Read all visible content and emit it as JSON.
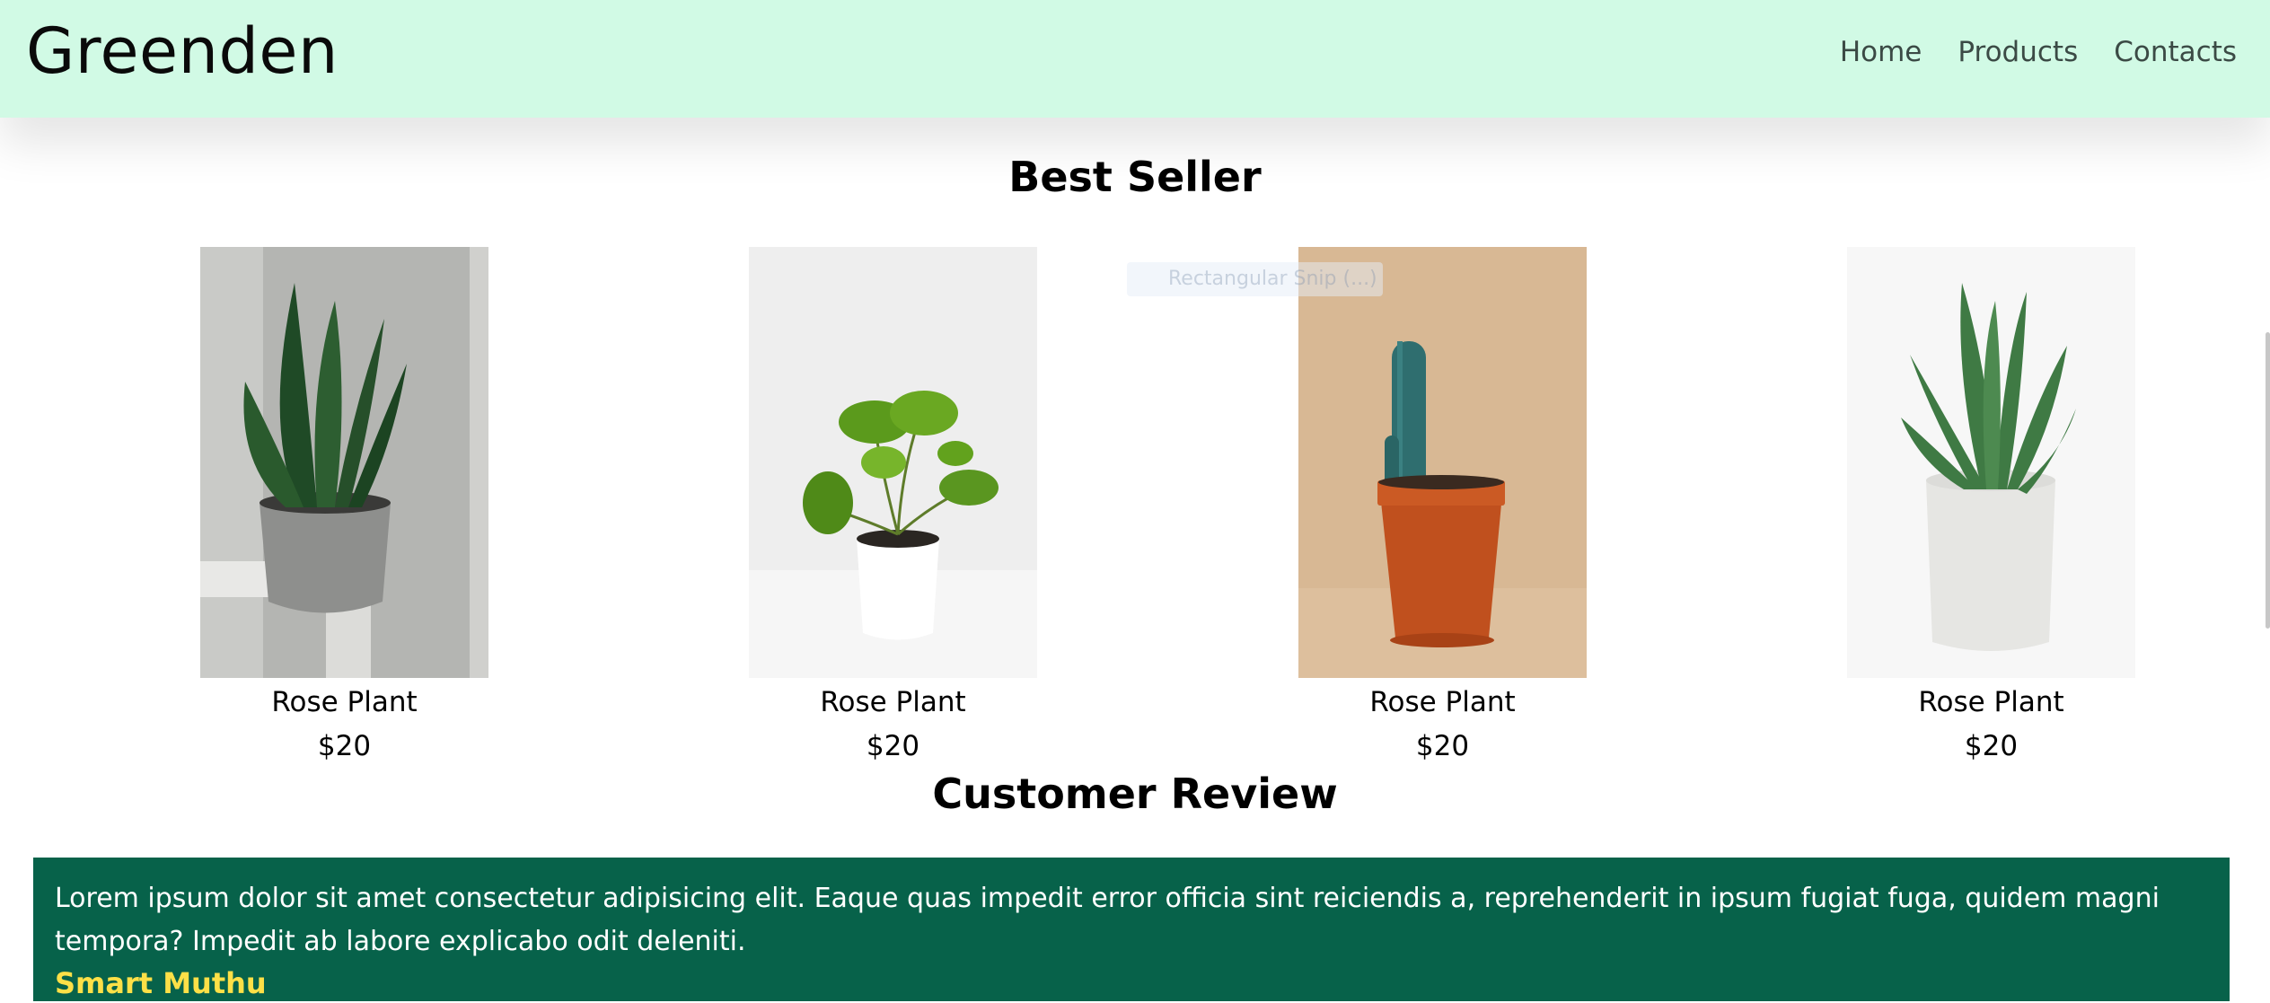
{
  "brand": "Greenden",
  "nav": [
    {
      "label": "Home"
    },
    {
      "label": "Products"
    },
    {
      "label": "Contacts"
    }
  ],
  "best_seller": {
    "title": "Best Seller",
    "products": [
      {
        "name": "Rose Plant",
        "price": "$20",
        "image": "snake-plant"
      },
      {
        "name": "Rose Plant",
        "price": "$20",
        "image": "pilea-plant"
      },
      {
        "name": "Rose Plant",
        "price": "$20",
        "image": "cactus"
      },
      {
        "name": "Rose Plant",
        "price": "$20",
        "image": "aloe-plant"
      }
    ]
  },
  "tooltip": "Rectangular Snip (...)",
  "review": {
    "title": "Customer Review",
    "text": "Lorem ipsum dolor sit amet consectetur adipisicing elit. Eaque quas impedit error officia sint reiciendis a, reprehenderit in ipsum fugiat fuga, quidem magni tempora? Impedit ab labore explicabo odit deleniti.",
    "author": "Smart Muthu"
  },
  "colors": {
    "navbar_bg": "#d1fae5",
    "review_bg": "#07624a",
    "author": "#fde047"
  }
}
